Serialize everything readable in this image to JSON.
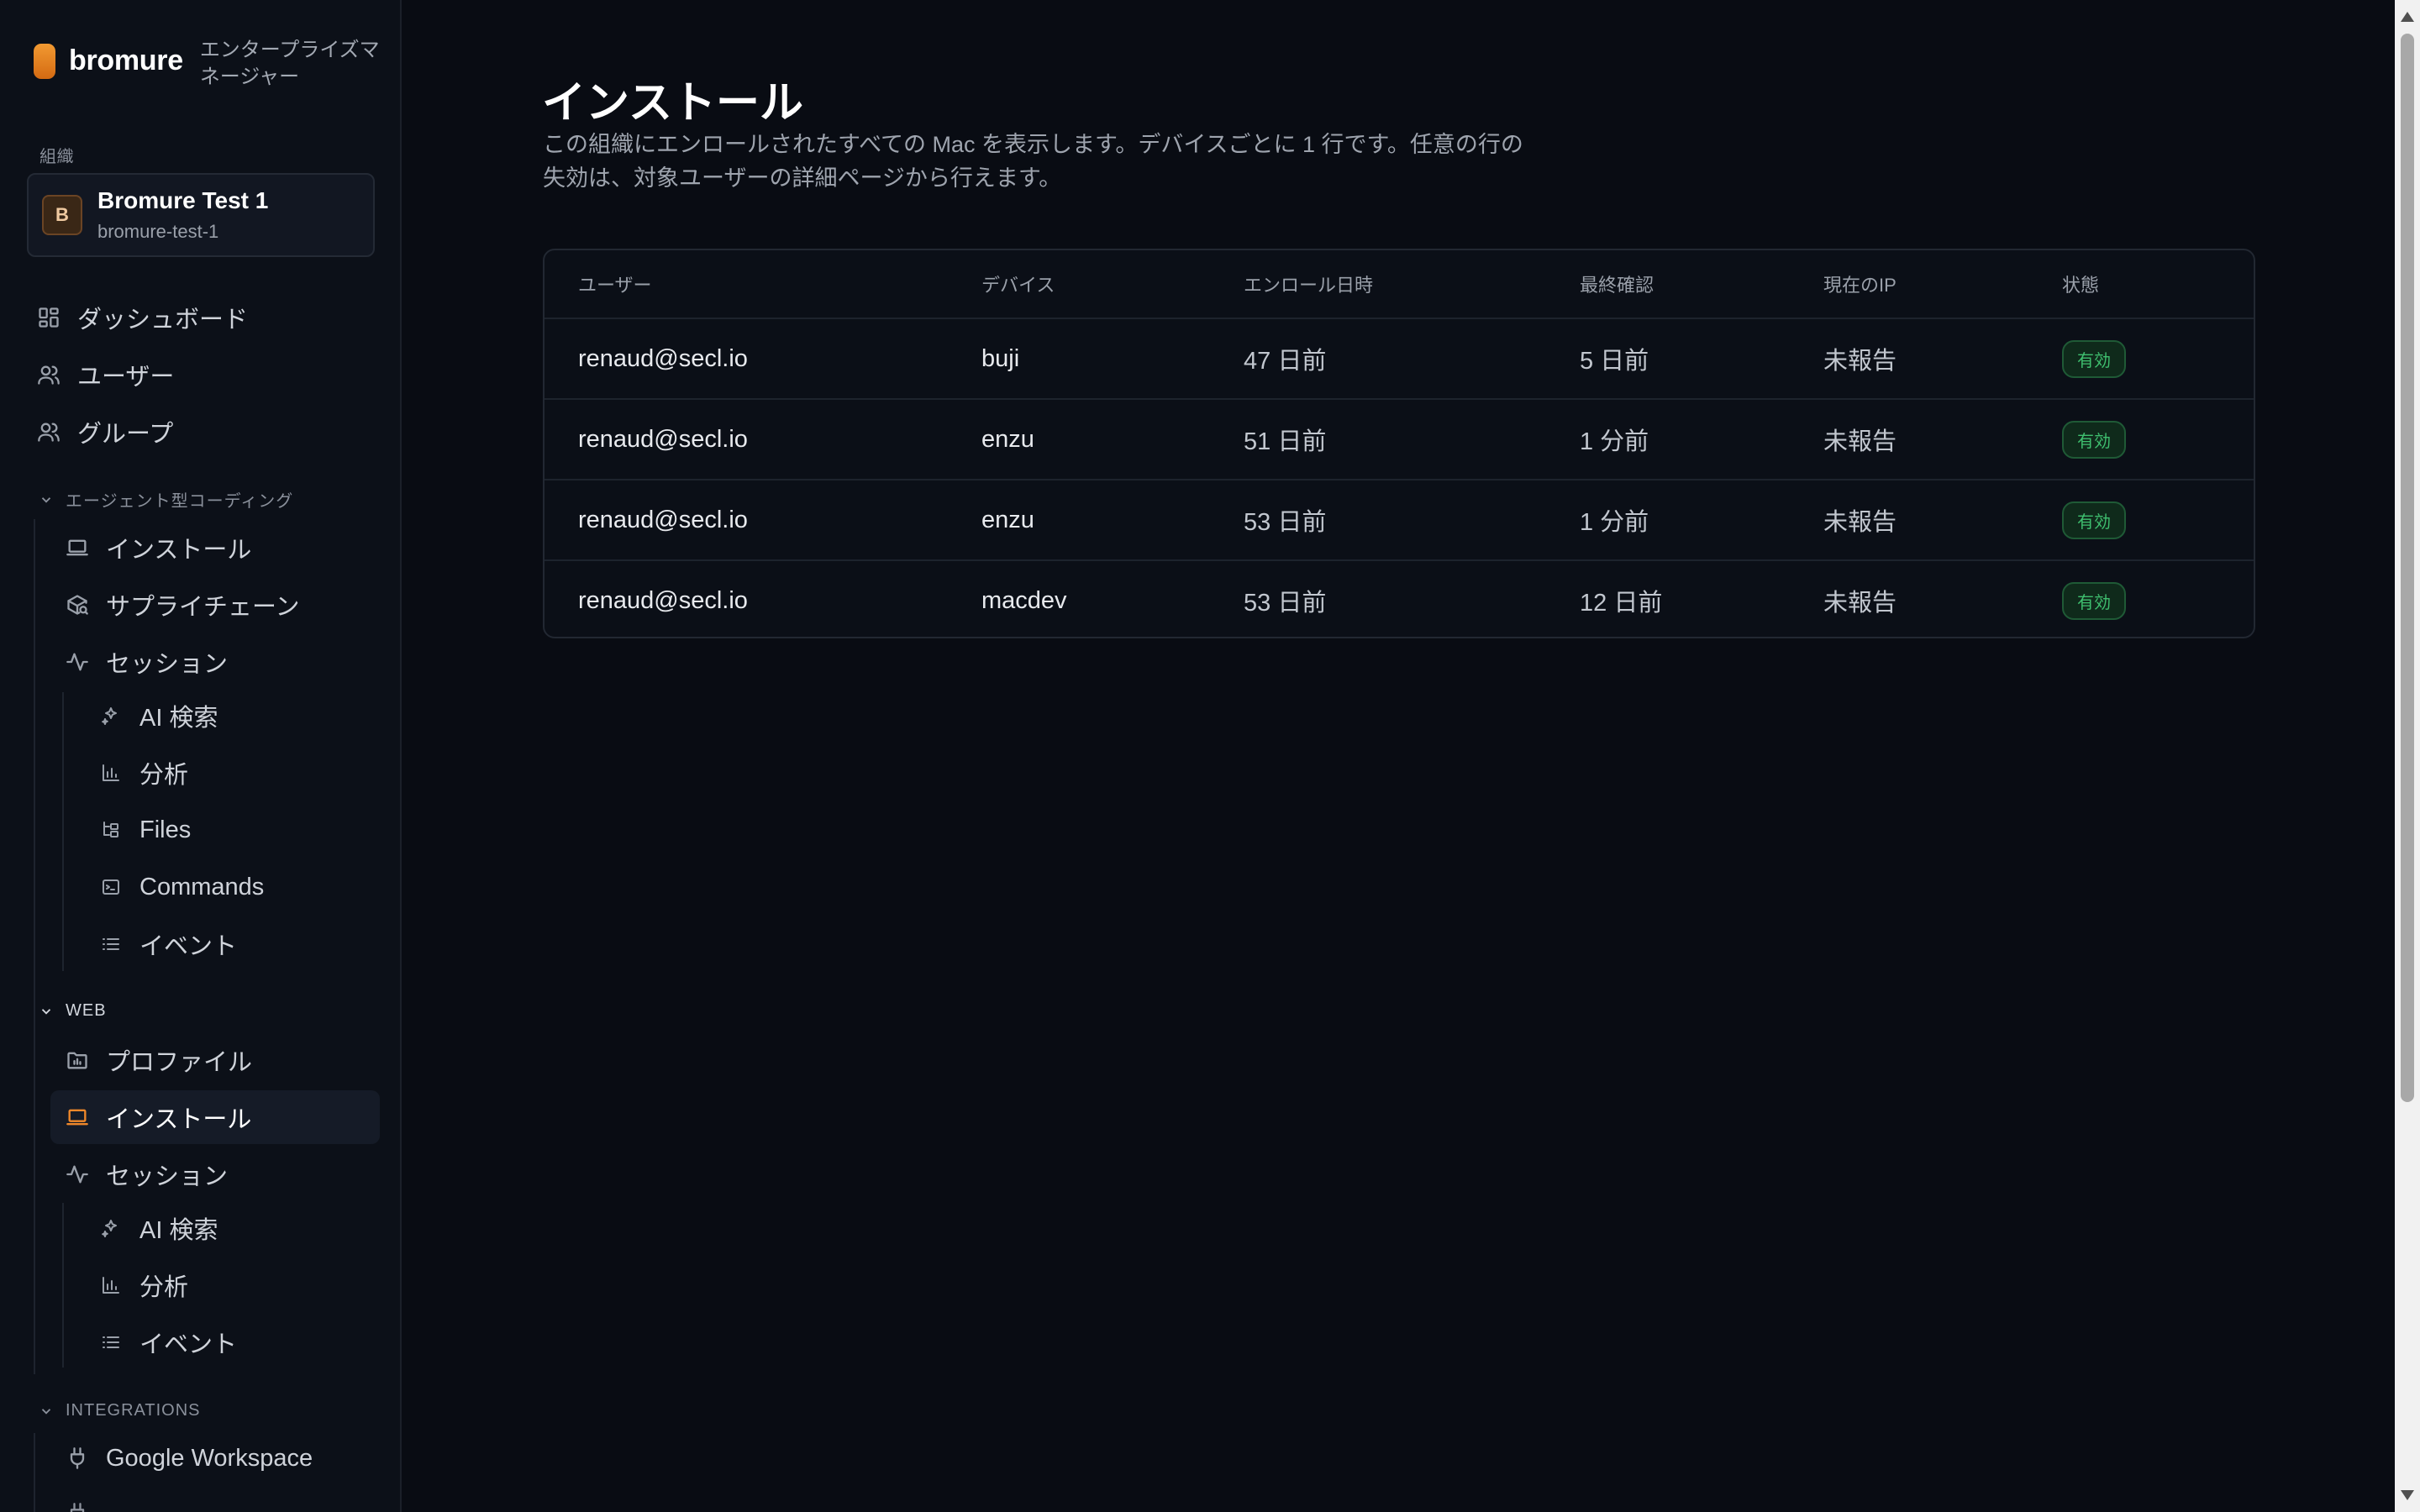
{
  "brand": {
    "name": "bromure",
    "subtitle": "エンタープライズマネージャー",
    "accent_color": "#f0882a"
  },
  "sidebar": {
    "org_label": "組織",
    "org": {
      "initial": "B",
      "name": "Bromure Test 1",
      "slug": "bromure-test-1"
    },
    "top_items": [
      {
        "label": "ダッシュボード",
        "icon": "dashboard-icon"
      },
      {
        "label": "ユーザー",
        "icon": "users-icon"
      },
      {
        "label": "グループ",
        "icon": "group-icon"
      }
    ],
    "agent_section": {
      "title": "エージェント型コーディング",
      "items": [
        {
          "label": "インストール",
          "icon": "laptop-icon"
        },
        {
          "label": "サプライチェーン",
          "icon": "package-search-icon"
        },
        {
          "label": "セッション",
          "icon": "activity-icon"
        }
      ],
      "session_children": [
        {
          "label": "AI 検索",
          "icon": "sparkles-icon"
        },
        {
          "label": "分析",
          "icon": "bar-chart-icon"
        },
        {
          "label": "Files",
          "icon": "folder-tree-icon"
        },
        {
          "label": "Commands",
          "icon": "terminal-icon"
        },
        {
          "label": "イベント",
          "icon": "list-icon"
        }
      ]
    },
    "web_section": {
      "title": "WEB",
      "items": [
        {
          "label": "プロファイル",
          "icon": "folder-chart-icon"
        },
        {
          "label": "インストール",
          "icon": "laptop-icon",
          "active": true
        },
        {
          "label": "セッション",
          "icon": "activity-icon"
        }
      ],
      "session_children": [
        {
          "label": "AI 検索",
          "icon": "sparkles-icon"
        },
        {
          "label": "分析",
          "icon": "bar-chart-icon"
        },
        {
          "label": "イベント",
          "icon": "list-icon"
        }
      ]
    },
    "integrations_section": {
      "title": "INTEGRATIONS",
      "items": [
        {
          "label": "Google Workspace",
          "icon": "plug-icon"
        }
      ]
    }
  },
  "main": {
    "title": "インストール",
    "description": "この組織にエンロールされたすべての Mac を表示します。デバイスごとに 1 行です。任意の行の失効は、対象ユーザーの詳細ページから行えます。",
    "table": {
      "columns": [
        "ユーザー",
        "デバイス",
        "エンロール日時",
        "最終確認",
        "現在のIP",
        "状態"
      ],
      "rows": [
        [
          "renaud@secl.io",
          "buji",
          "47 日前",
          "5 日前",
          "未報告",
          "有効"
        ],
        [
          "renaud@secl.io",
          "enzu",
          "51 日前",
          "1 分前",
          "未報告",
          "有効"
        ],
        [
          "renaud@secl.io",
          "enzu",
          "53 日前",
          "1 分前",
          "未報告",
          "有効"
        ],
        [
          "renaud@secl.io",
          "macdev",
          "53 日前",
          "12 日前",
          "未報告",
          "有効"
        ]
      ]
    },
    "status_color": "#3fbf6f"
  }
}
